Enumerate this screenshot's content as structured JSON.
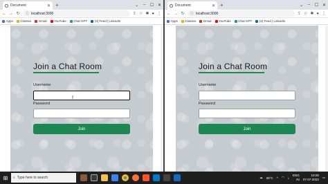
{
  "browser_left": {
    "tab_title": "Document",
    "url": "localhost:3000",
    "bookmarks": [
      {
        "label": "Apps",
        "color": "#4a6ee0"
      },
      {
        "label": "Classes",
        "color": "#e8b21f"
      },
      {
        "label": "Gmail",
        "color": "#d93025"
      },
      {
        "label": "YouTube",
        "color": "#ff0000"
      },
      {
        "label": "Chat GPT",
        "color": "#10a37f"
      },
      {
        "label": "(3) Feed | LinkedIn",
        "color": "#0a66c2"
      }
    ],
    "form": {
      "heading": "Join a Chat Room",
      "username_label": "Username",
      "username_value": "",
      "password_label": "Password",
      "password_value": "",
      "button_label": "Join"
    }
  },
  "browser_right": {
    "tab_title": "Document",
    "url": "localhost:3000",
    "bookmarks": [
      {
        "label": "Apps",
        "color": "#4a6ee0"
      },
      {
        "label": "Classes",
        "color": "#e8b21f"
      },
      {
        "label": "Gmail",
        "color": "#d93025"
      },
      {
        "label": "YouTube",
        "color": "#ff0000"
      },
      {
        "label": "Chat GPT",
        "color": "#10a37f"
      },
      {
        "label": "(3) Feed | LinkedIn",
        "color": "#0a66c2"
      }
    ],
    "form": {
      "heading": "Join a Chat Room",
      "username_label": "Username",
      "username_value": "",
      "password_label": "Password",
      "password_value": "",
      "button_label": "Join"
    }
  },
  "taskbar": {
    "search_placeholder": "Type here to search",
    "weather": "26°C",
    "language": "ENG",
    "language_region": "IN",
    "time": "10:08",
    "date": "07-07-2023"
  },
  "colors": {
    "accent_green": "#1c8752",
    "page_background": "#c6cbcf"
  }
}
